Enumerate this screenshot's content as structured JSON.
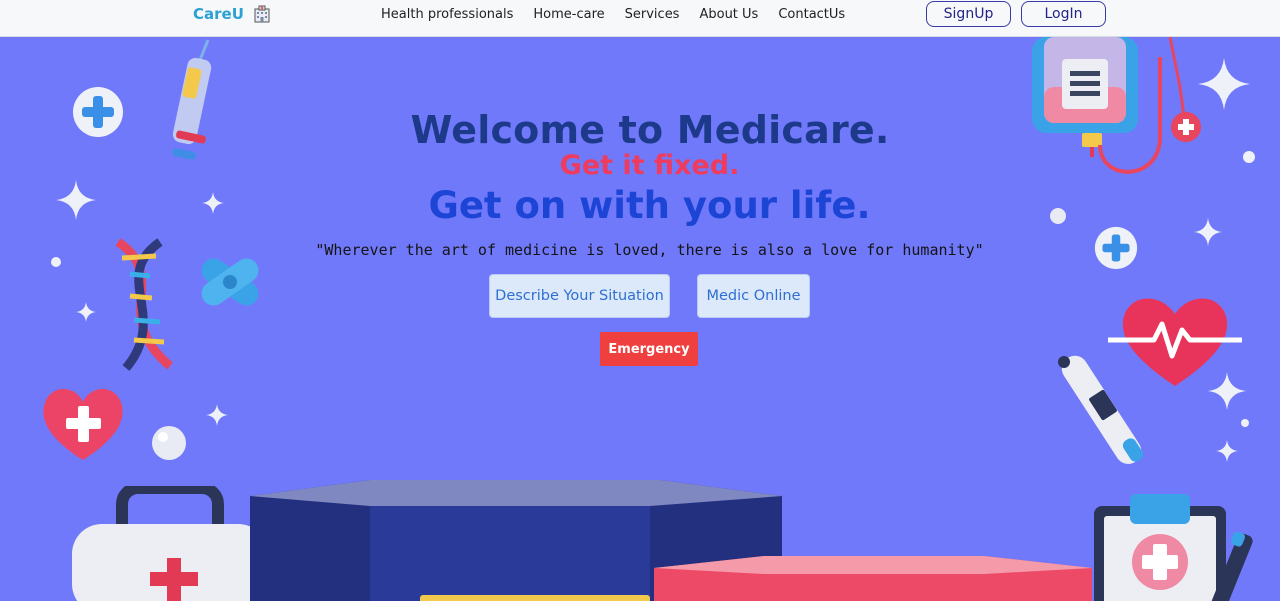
{
  "navbar": {
    "brand_name": "CareU",
    "brand_icon": "hospital-icon",
    "links": [
      "Health professionals",
      "Home-care",
      "Services",
      "About Us",
      "ContactUs"
    ],
    "signup_label": "SignUp",
    "login_label": "LogIn"
  },
  "hero": {
    "title": "Welcome to Medicare.",
    "subtitle_1": "Get it fixed.",
    "subtitle_2": "Get on with your life.",
    "quote": "\"Wherever the art of medicine is loved, there is also a love for humanity\"",
    "describe_button": "Describe Your Situation",
    "medic_button": "Medic Online",
    "emergency_button": "Emergency"
  },
  "colors": {
    "background": "#7179fb",
    "brand": "#2aa0d4",
    "title": "#1d3a8a",
    "accent_red": "#ef3b5d",
    "accent_blue": "#1c45d6",
    "emergency": "#ef3f3f"
  },
  "decorations": [
    "syringe-icon",
    "plus-badge-icon",
    "sparkle-icon",
    "dna-icon",
    "bandage-icon",
    "heart-plus-icon",
    "pearl-icon",
    "first-aid-kit-icon",
    "podium-icon",
    "iv-bag-icon",
    "stethoscope-icon",
    "heartbeat-icon",
    "thermometer-icon",
    "clipboard-icon",
    "pen-icon"
  ]
}
